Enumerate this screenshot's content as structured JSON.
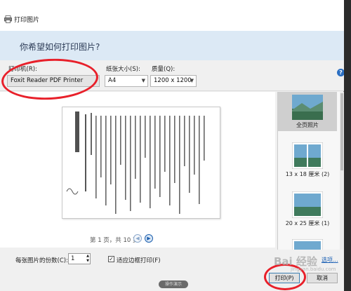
{
  "window": {
    "title": "打印图片"
  },
  "question": {
    "text": "你希望如何打印图片?"
  },
  "settings": {
    "printer_label": "打印机(R):",
    "printer_value": "Foxit Reader PDF Printer",
    "paper_label": "纸张大小(S):",
    "paper_value": "A4",
    "quality_label": "质量(Q):",
    "quality_value": "1200 x 1200"
  },
  "preview": {
    "pager_text": "第 1 页，共 10 页"
  },
  "layouts": [
    {
      "label": "全页照片",
      "selected": true
    },
    {
      "label": "13 x 18 厘米 (2)",
      "selected": false
    },
    {
      "label": "20 x 25 厘米 (1)",
      "selected": false
    }
  ],
  "bottom": {
    "copies_label": "每张图片的份数(C):",
    "copies_value": "1",
    "fit_label": "适应边框打印(F)",
    "fit_checked": true,
    "options_link": "选项...",
    "print_button": "打印(P)",
    "cancel_button": "取消"
  },
  "taskbar": {
    "pill": "操作演示"
  },
  "watermark": {
    "brand": "Bai 经验",
    "url": "jingyan.baidu.com"
  },
  "colors": {
    "highlight_ellipse": "#e8202a",
    "accent": "#2b6fc2"
  }
}
